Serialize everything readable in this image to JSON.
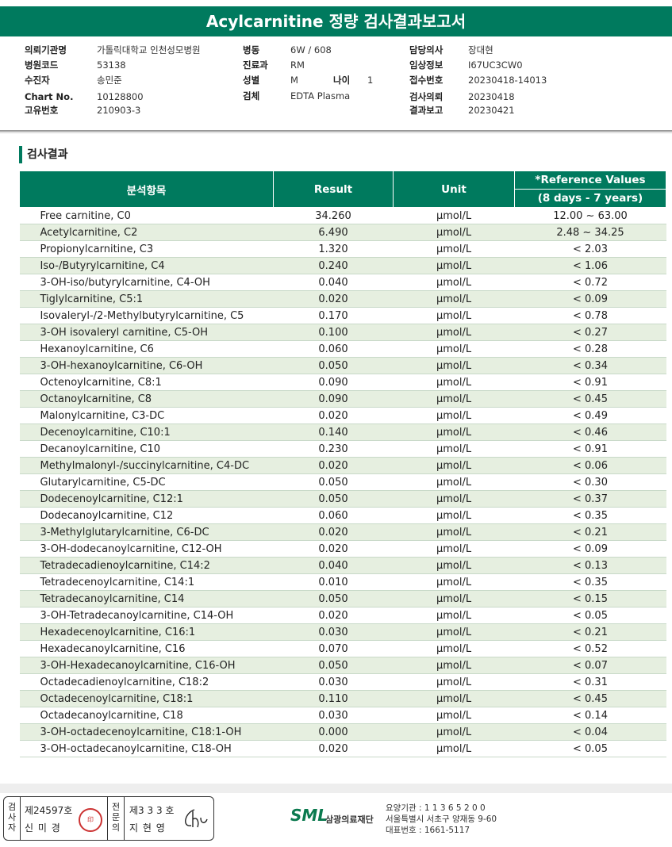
{
  "title": "Acylcarnitine 정량 검사결과보고서",
  "header": {
    "col1": [
      {
        "label": "의뢰기관명",
        "value": "가톨릭대학교 인천성모병원"
      },
      {
        "label": "병원코드",
        "value": "53138"
      },
      {
        "label": "수진자",
        "value": "송민준"
      },
      {
        "label": "Chart No.",
        "value": "10128800"
      },
      {
        "label": "고유번호",
        "value": "210903-3"
      }
    ],
    "col2": [
      {
        "label": "병동",
        "value": "6W / 608"
      },
      {
        "label": "진료과",
        "value": "RM"
      },
      {
        "label": "성별",
        "value": "M"
      },
      {
        "label": "검체",
        "value": "EDTA Plasma"
      }
    ],
    "age_label": "나이",
    "age_value": "1",
    "col3": [
      {
        "label": "담당의사",
        "value": "장대현"
      },
      {
        "label": "임상정보",
        "value": "I67UC3CW0"
      },
      {
        "label": "접수번호",
        "value": "20230418-14013"
      },
      {
        "label": "검사의뢰",
        "value": "20230418"
      },
      {
        "label": "결과보고",
        "value": "20230421"
      }
    ]
  },
  "section_title": "검사결과",
  "table": {
    "headers": {
      "name": "분석항목",
      "result": "Result",
      "unit": "Unit",
      "ref1": "*Reference Values",
      "ref2": "(8 days - 7 years)"
    },
    "rows": [
      [
        "Free carnitine, C0",
        "34.260",
        "μmol/L",
        "12.00 ~ 63.00"
      ],
      [
        "Acetylcarnitine, C2",
        "6.490",
        "μmol/L",
        "2.48 ~ 34.25"
      ],
      [
        "Propionylcarnitine, C3",
        "1.320",
        "μmol/L",
        "< 2.03"
      ],
      [
        "Iso-/Butyrylcarnitine, C4",
        "0.240",
        "μmol/L",
        "< 1.06"
      ],
      [
        "3-OH-iso/butyrylcarnitine, C4-OH",
        "0.040",
        "μmol/L",
        "< 0.72"
      ],
      [
        "Tiglylcarnitine, C5:1",
        "0.020",
        "μmol/L",
        "< 0.09"
      ],
      [
        "Isovaleryl-/2-Methylbutyrylcarnitine, C5",
        "0.170",
        "μmol/L",
        "< 0.78"
      ],
      [
        "3-OH isovaleryl carnitine, C5-OH",
        "0.100",
        "μmol/L",
        "< 0.27"
      ],
      [
        "Hexanoylcarnitine, C6",
        "0.060",
        "μmol/L",
        "< 0.28"
      ],
      [
        "3-OH-hexanoylcarnitine, C6-OH",
        "0.050",
        "μmol/L",
        "< 0.34"
      ],
      [
        "Octenoylcarnitine, C8:1",
        "0.090",
        "μmol/L",
        "< 0.91"
      ],
      [
        "Octanoylcarnitine, C8",
        "0.090",
        "μmol/L",
        "< 0.45"
      ],
      [
        "Malonylcarnitine, C3-DC",
        "0.020",
        "μmol/L",
        "< 0.49"
      ],
      [
        "Decenoylcarnitine, C10:1",
        "0.140",
        "μmol/L",
        "< 0.46"
      ],
      [
        "Decanoylcarnitine, C10",
        "0.230",
        "μmol/L",
        "< 0.91"
      ],
      [
        "Methylmalonyl-/succinylcarnitine, C4-DC",
        "0.020",
        "μmol/L",
        "< 0.06"
      ],
      [
        "Glutarylcarnitine, C5-DC",
        "0.050",
        "μmol/L",
        "< 0.30"
      ],
      [
        "Dodecenoylcarnitine, C12:1",
        "0.050",
        "μmol/L",
        "< 0.37"
      ],
      [
        "Dodecanoylcarnitine, C12",
        "0.060",
        "μmol/L",
        "< 0.35"
      ],
      [
        "3-Methylglutarylcarnitine, C6-DC",
        "0.020",
        "μmol/L",
        "< 0.21"
      ],
      [
        "3-OH-dodecanoylcarnitine, C12-OH",
        "0.020",
        "μmol/L",
        "< 0.09"
      ],
      [
        "Tetradecadienoylcarnitine, C14:2",
        "0.040",
        "μmol/L",
        "< 0.13"
      ],
      [
        "Tetradecenoylcarnitine, C14:1",
        "0.010",
        "μmol/L",
        "< 0.35"
      ],
      [
        "Tetradecanoylcarnitine, C14",
        "0.050",
        "μmol/L",
        "< 0.15"
      ],
      [
        "3-OH-Tetradecanoylcarnitine, C14-OH",
        "0.020",
        "μmol/L",
        "< 0.05"
      ],
      [
        "Hexadecenoylcarnitine, C16:1",
        "0.030",
        "μmol/L",
        "< 0.21"
      ],
      [
        "Hexadecanoylcarnitine, C16",
        "0.070",
        "μmol/L",
        "< 0.52"
      ],
      [
        "3-OH-Hexadecanoylcarnitine, C16-OH",
        "0.050",
        "μmol/L",
        "< 0.07"
      ],
      [
        "Octadecadienoylcarnitine, C18:2",
        "0.030",
        "μmol/L",
        "< 0.31"
      ],
      [
        "Octadecenoylcarnitine, C18:1",
        "0.110",
        "μmol/L",
        "< 0.45"
      ],
      [
        "Octadecanoylcarnitine, C18",
        "0.030",
        "μmol/L",
        "< 0.14"
      ],
      [
        "3-OH-octadecenoylcarnitine, C18:1-OH",
        "0.000",
        "μmol/L",
        "< 0.04"
      ],
      [
        "3-OH-octadecanoylcarnitine, C18-OH",
        "0.020",
        "μmol/L",
        "< 0.05"
      ]
    ]
  },
  "footer": {
    "tester_label": "검사자",
    "tester_no": "제24597호",
    "tester_name": "신 미 경",
    "specialist_label": "전문의",
    "specialist_no": "제3 3 3 호",
    "specialist_name": "지 현 영",
    "logo": "SML",
    "org": "삼광의료재단",
    "info1": "요양기관 : 1 1 3 6 5 2 0 0",
    "info2": "서울특별시 서초구 양재동 9-60",
    "info3": "대표번호 : 1661-5117"
  },
  "colors": {
    "accent": "#007a5e",
    "alt_row": "#e6efe0"
  }
}
